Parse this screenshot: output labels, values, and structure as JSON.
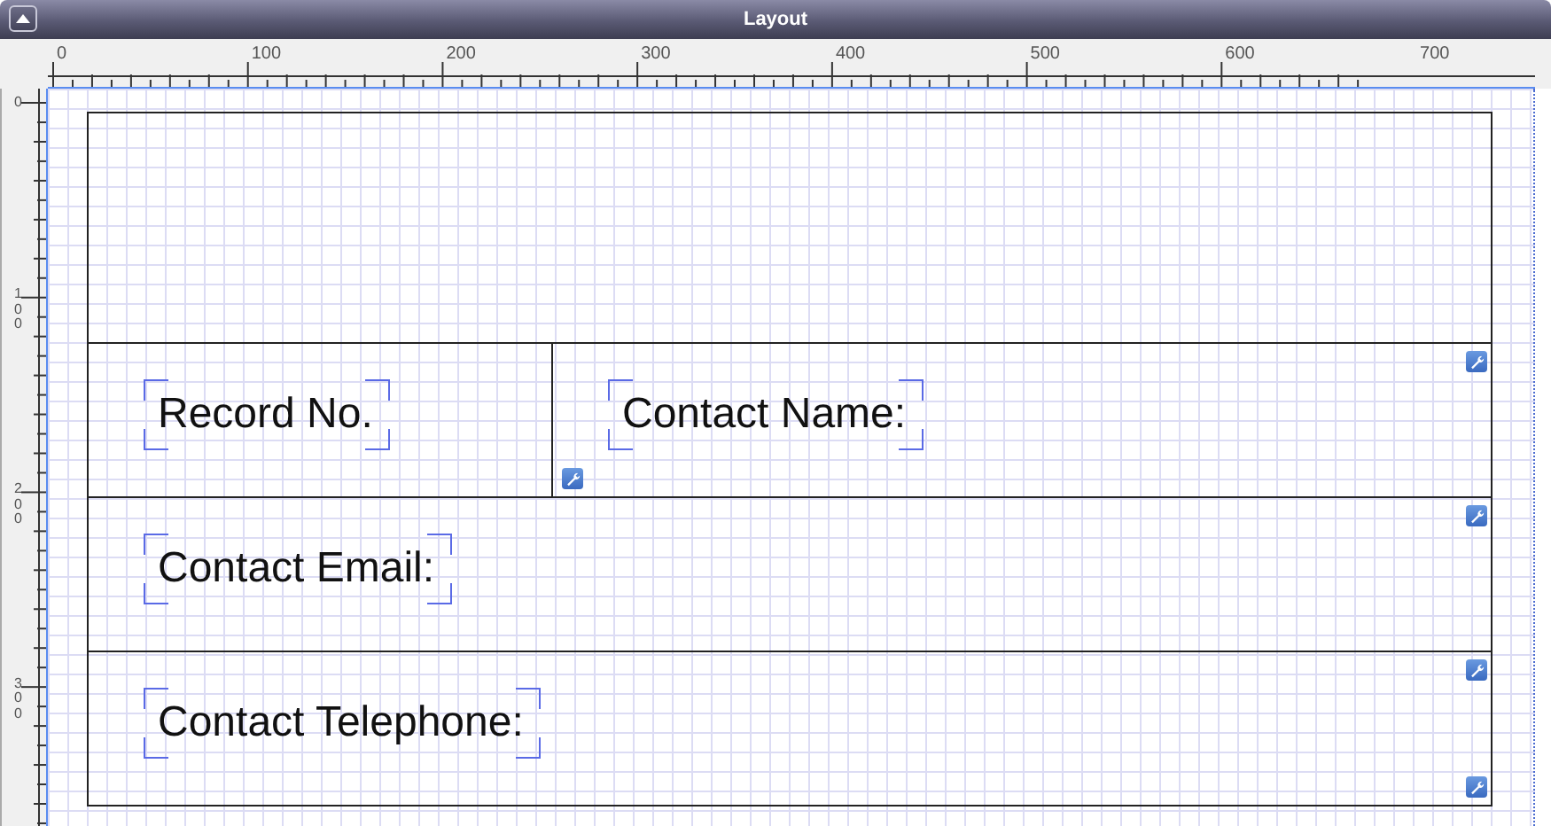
{
  "window": {
    "title": "Layout"
  },
  "ruler": {
    "top_labels": [
      "0",
      "100",
      "200",
      "300",
      "400",
      "500",
      "600",
      "700"
    ],
    "left_labels": [
      "0",
      "100",
      "200",
      "300"
    ]
  },
  "layout_parts": [
    {
      "kind": "header"
    },
    {
      "kind": "body",
      "fields": [
        {
          "label": "Record No."
        },
        {
          "label": "Contact Name:"
        }
      ]
    },
    {
      "kind": "body",
      "fields": [
        {
          "label": "Contact Email:"
        }
      ]
    },
    {
      "kind": "body",
      "fields": [
        {
          "label": "Contact Telephone:"
        }
      ]
    }
  ]
}
